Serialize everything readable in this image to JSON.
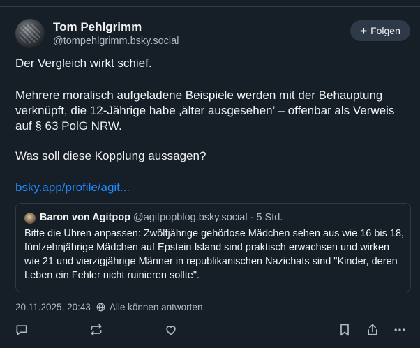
{
  "author": {
    "name": "Tom Pehlgrimm",
    "handle": "@tompehlgrimm.bsky.social"
  },
  "follow_button": {
    "icon": "plus-icon",
    "label": "Folgen"
  },
  "post": {
    "paragraph_1": "Der Vergleich wirkt schief.",
    "paragraph_2": "Mehrere moralisch aufgeladene Beispiele werden mit der Behauptung verknüpft, die 12-Jährige habe ‚älter ausgesehen’ – offenbar als Verweis auf § 63 PolG NRW.",
    "paragraph_3": "Was soll diese Kopplung aussagen?",
    "link": "bsky.app/profile/agit..."
  },
  "quoted_post": {
    "author_name": "Baron von Agitpop",
    "author_handle": "@agitpopblog.bsky.social",
    "separator": " · ",
    "age": "5 Std.",
    "text": "Bitte die Uhren anpassen: Zwölfjährige gehörlose Mädchen sehen aus wie 16 bis 18, fünfzehnjährige Mädchen auf Epstein Island sind praktisch erwachsen und wirken wie 21 und vierzigjährige Männer in republikanischen Nazichats sind \"Kinder, deren Leben ein Fehler nicht ruinieren sollte\"."
  },
  "meta": {
    "timestamp": "20.11.2025, 20:43",
    "reply_setting": "Alle können antworten"
  },
  "colors": {
    "background": "#161e27",
    "text": "#f1f3f5",
    "muted": "#aebbc9",
    "link": "#208bfe",
    "border": "#2e3a47"
  },
  "actions": [
    "reply-icon",
    "repost-icon",
    "like-icon",
    "bookmark-icon",
    "share-icon",
    "more-icon"
  ]
}
